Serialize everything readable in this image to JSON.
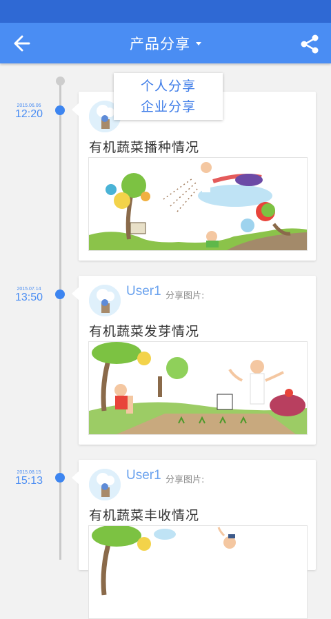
{
  "header": {
    "title": "产品分享",
    "back_icon": "arrow-left-icon",
    "share_icon": "share-icon",
    "colors": {
      "statusbar": "#2f69d4",
      "appbar": "#4a8df3"
    }
  },
  "dropdown": {
    "options": [
      "个人分享",
      "企业分享"
    ]
  },
  "posts": [
    {
      "date": "2015.06.06",
      "time": "12:20",
      "user": "",
      "share_label": "",
      "title": "有机蔬菜播种情况",
      "image": "cartoon-seeding-illustration"
    },
    {
      "date": "2015.07.14",
      "time": "13:50",
      "user": "User1",
      "share_label": "分享图片:",
      "title": "有机蔬菜发芽情况",
      "image": "cartoon-sprouting-illustration"
    },
    {
      "date": "2015.08.15",
      "time": "15:13",
      "user": "User1",
      "share_label": "分享图片:",
      "title": "有机蔬菜丰收情况",
      "image": "cartoon-harvest-illustration"
    }
  ]
}
